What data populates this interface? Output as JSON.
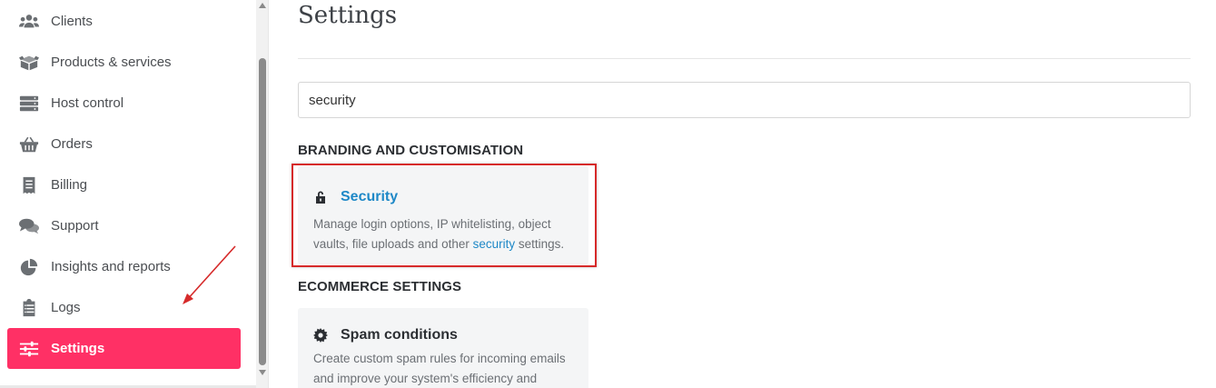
{
  "sidebar": {
    "items": [
      {
        "label": "Clients",
        "icon": "users-icon"
      },
      {
        "label": "Products & services",
        "icon": "box-icon"
      },
      {
        "label": "Host control",
        "icon": "server-icon"
      },
      {
        "label": "Orders",
        "icon": "basket-icon"
      },
      {
        "label": "Billing",
        "icon": "receipt-icon"
      },
      {
        "label": "Support",
        "icon": "chat-bubbles-icon"
      },
      {
        "label": "Insights and reports",
        "icon": "pie-chart-icon"
      },
      {
        "label": "Logs",
        "icon": "clipboard-icon"
      },
      {
        "label": "Settings",
        "icon": "sliders-icon",
        "active": true
      }
    ]
  },
  "main": {
    "title": "Settings",
    "search": {
      "value": "security"
    },
    "sections": [
      {
        "heading": "BRANDING AND CUSTOMISATION",
        "card": {
          "title": "Security",
          "icon": "unlock-icon",
          "desc_before": "Manage login options, IP whitelisting, object vaults, file uploads and other ",
          "desc_highlight": "security",
          "desc_after": " settings."
        }
      },
      {
        "heading": "ECOMMERCE SETTINGS",
        "card": {
          "title": "Spam conditions",
          "icon": "gear-icon",
          "desc": "Create custom spam rules for incoming emails and improve your system's efficiency and"
        }
      }
    ]
  },
  "colors": {
    "accent": "#ff3065",
    "link": "#1e88c7",
    "highlight_box": "#d62a2a"
  }
}
